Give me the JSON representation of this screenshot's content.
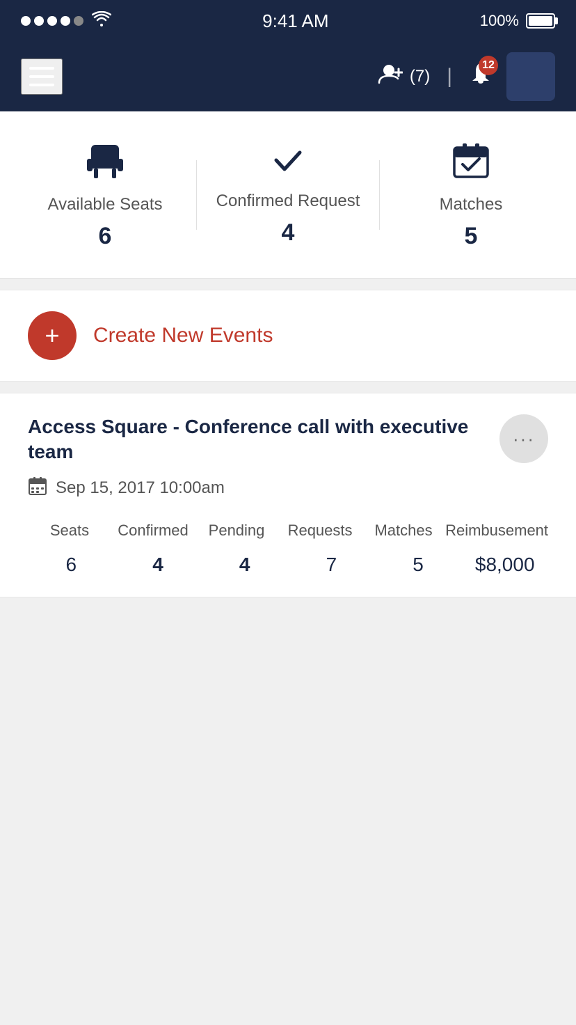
{
  "status_bar": {
    "time": "9:41 AM",
    "battery_pct": "100%"
  },
  "nav": {
    "menu_label": "Menu",
    "user_count": "(7)",
    "notification_badge": "12",
    "bell_label": "Notifications"
  },
  "stats": {
    "available_seats": {
      "label": "Available Seats",
      "value": "6"
    },
    "confirmed_request": {
      "label": "Confirmed Request",
      "value": "4"
    },
    "matches": {
      "label": "Matches",
      "value": "5"
    }
  },
  "create_events": {
    "label": "Create New Events"
  },
  "event": {
    "title": "Access Square - Conference call with executive team",
    "date": "Sep 15, 2017  10:00am",
    "table": {
      "headers": [
        "Seats",
        "Confirmed",
        "Pending",
        "Requests",
        "Matches",
        "Reimbusement"
      ],
      "values": [
        "6",
        "4",
        "4",
        "7",
        "5",
        "$8,000"
      ]
    }
  }
}
